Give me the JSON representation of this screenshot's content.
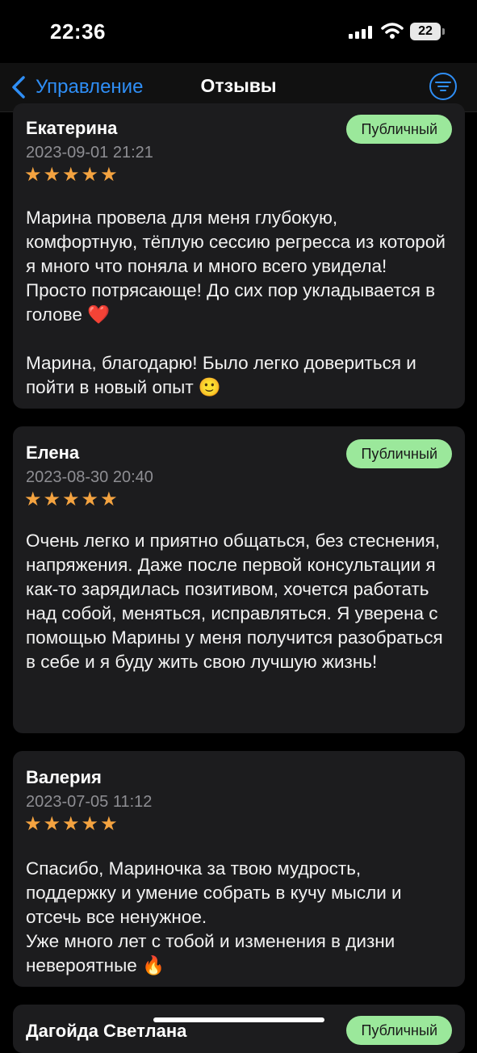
{
  "status_bar": {
    "time": "22:36",
    "battery": "22"
  },
  "nav": {
    "back_label": "Управление",
    "title": "Отзывы"
  },
  "reviews": [
    {
      "name": "Екатерина",
      "date": "2023-09-01 21:21",
      "rating": 5,
      "stars": "★★★★★",
      "visibility": "Публичный",
      "text": "Марина провела для меня глубокую, комфортную, тёплую сессию регресса из которой я много что поняла и много всего увидела! Просто потрясающе! До сих пор укладывается в голове ❤️\n\nМарина, благодарю! Было легко довериться и пойти в новый опыт 🙂"
    },
    {
      "name": "Елена",
      "date": "2023-08-30 20:40",
      "rating": 5,
      "stars": "★★★★★",
      "visibility": "Публичный",
      "text": "Очень легко и приятно общаться, без стеснения, напряжения. Даже после первой консультации я как-то зарядилась позитивом, хочется работать над собой, меняться, исправляться. Я уверена с помощью Марины у меня получится разобраться в себе и я буду жить свою лучшую жизнь!"
    },
    {
      "name": "Валерия",
      "date": "2023-07-05 11:12",
      "rating": 5,
      "stars": "★★★★★",
      "visibility": "",
      "text": "Спасибо, Мариночка за твою мудрость, поддержку и умение собрать в кучу мысли и отсечь все ненужное.\nУже много лет с тобой и изменения в дизни невероятные 🔥"
    },
    {
      "name": "Дагойда Светлана",
      "visibility": "Публичный"
    }
  ],
  "colors": {
    "accent": "#2f8ef5",
    "badge": "#9be89b",
    "star": "#f4a340",
    "card": "#1c1c1e"
  },
  "icons": {
    "back": "chevron-left-icon",
    "filter": "filter-lines-icon",
    "signal": "cellular-signal-icon",
    "wifi": "wifi-icon"
  }
}
